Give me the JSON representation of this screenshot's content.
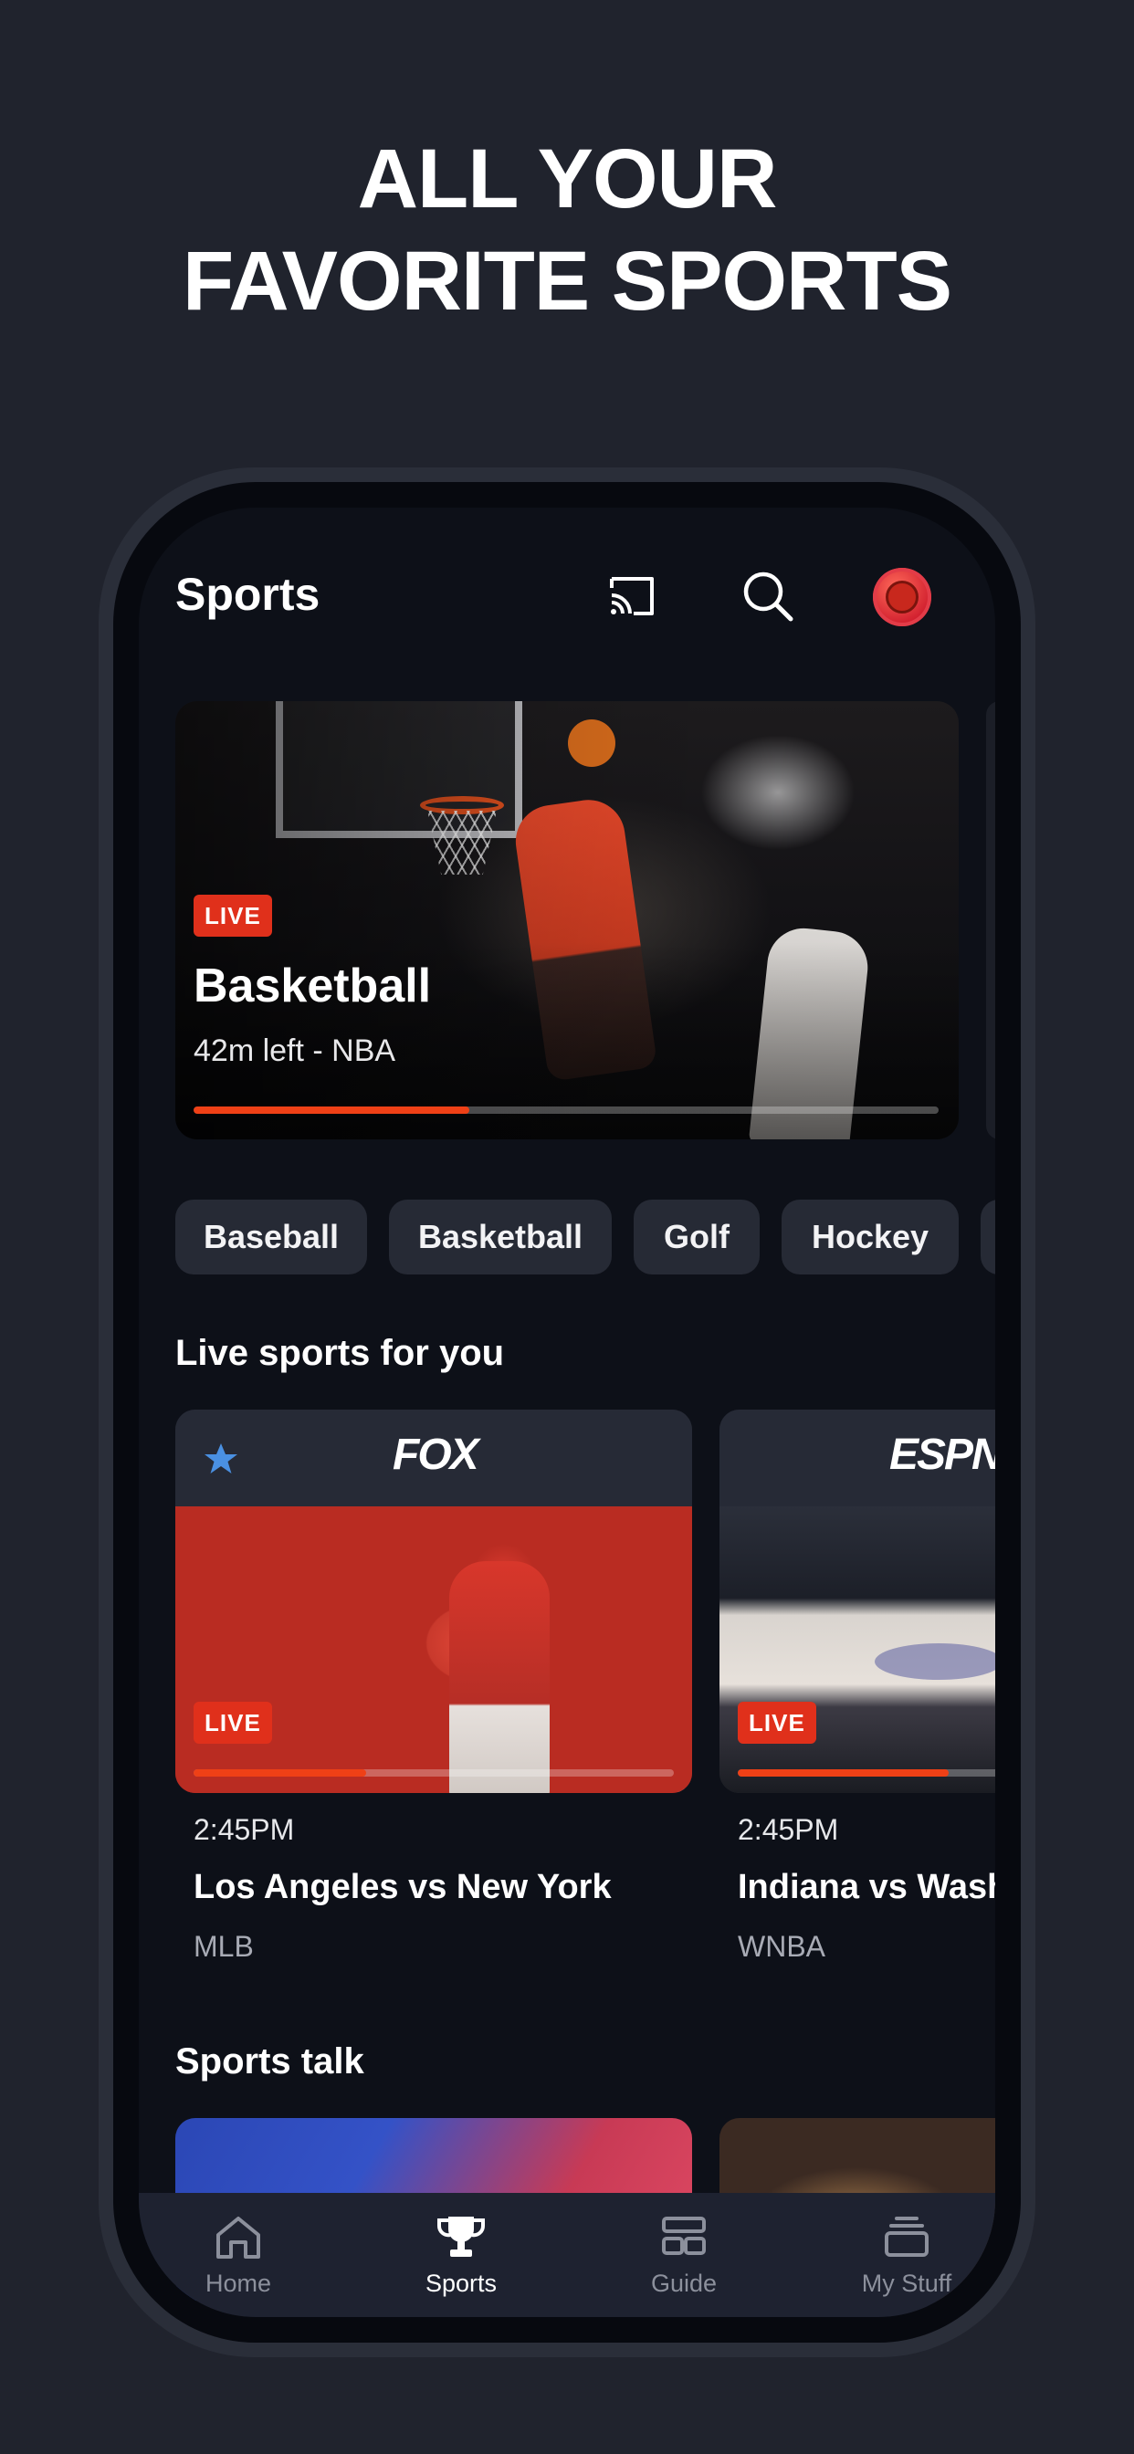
{
  "headline": {
    "line1": "ALL YOUR",
    "line2": "FAVORITE SPORTS"
  },
  "app_bar": {
    "title": "Sports",
    "icons": [
      "cast-icon",
      "search-icon",
      "avatar-basketball-icon"
    ]
  },
  "hero": {
    "badge": "LIVE",
    "title": "Basketball",
    "subtitle": "42m left - NBA",
    "progress": 0.37
  },
  "chips": [
    "Baseball",
    "Basketball",
    "Golf",
    "Hockey"
  ],
  "live_section": {
    "title": "Live sports for you",
    "cards": [
      {
        "network": "FOX",
        "favorite": true,
        "badge": "LIVE",
        "progress": 0.36,
        "time": "2:45PM",
        "title": "Los Angeles vs New York",
        "league": "MLB"
      },
      {
        "network": "ESPN",
        "favorite": false,
        "badge": "LIVE",
        "progress": 0.44,
        "time": "2:45PM",
        "title": "Indiana vs Washington",
        "league": "WNBA"
      }
    ]
  },
  "talk_section": {
    "title": "Sports talk"
  },
  "bottom_nav": {
    "items": [
      {
        "label": "Home",
        "icon": "home-icon",
        "active": false
      },
      {
        "label": "Sports",
        "icon": "trophy-icon",
        "active": true
      },
      {
        "label": "Guide",
        "icon": "guide-icon",
        "active": false
      },
      {
        "label": "My Stuff",
        "icon": "stack-icon",
        "active": false
      }
    ]
  },
  "colors": {
    "background": "#20232d",
    "accent": "#ef4016",
    "live": "#e0301b",
    "star": "#4a90e2"
  }
}
